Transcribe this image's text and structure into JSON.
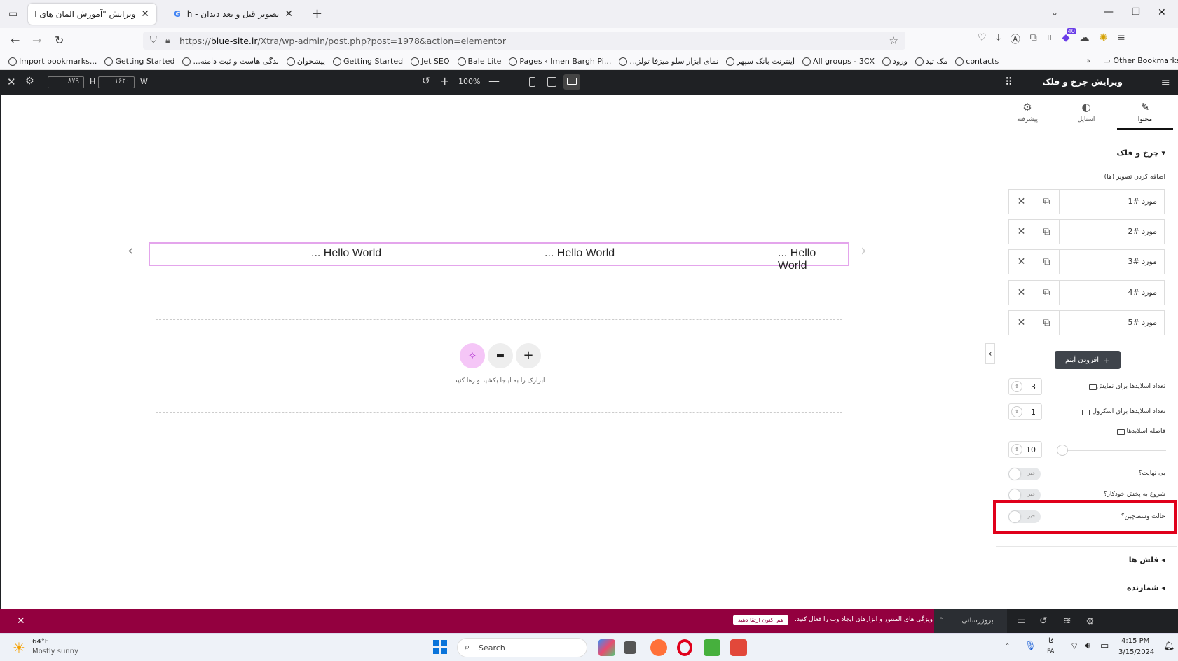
{
  "browser": {
    "tabs": [
      {
        "title": "ویرایش \"آموزش المان های اکسترا – ا"
      },
      {
        "title": "تصویر قبل و بعد دندان - Search"
      }
    ],
    "url_prefix": "https://",
    "url_host": "blue-site.ir",
    "url_path": "/Xtra/wp-admin/post.php?post=1978&action=elementor",
    "bookmarks": [
      "Import bookmarks...",
      "Getting Started",
      "...ندگی هاست و ثبت دامنه",
      "پیشخوان",
      "Getting Started",
      "Jet SEO",
      "Bale Lite",
      "Pages ‹ Imen Bargh Pi...",
      "...نمای ابزار سلو میزفا تولز",
      "اینترنت بانک سپهر",
      "All groups - 3CX",
      "ورود",
      "مک تید",
      "contacts"
    ],
    "other_bookmarks": "Other Bookmarks",
    "extension_badge": "40"
  },
  "editor_top": {
    "height_label": "H",
    "height_value": "۸۷۹",
    "width_label": "W",
    "width_value": "۱۶۲۰",
    "zoom": "100%"
  },
  "canvas": {
    "slides": [
      "... Hello World",
      "... Hello World",
      "... Hello World"
    ],
    "drop_hint": "ابزارک را به اینجا بکشید و رها کنید"
  },
  "panel": {
    "title": "ویرایش چرخ و فلک",
    "tabs": [
      {
        "label": "محتوا"
      },
      {
        "label": "استایل"
      },
      {
        "label": "پیشرفته"
      }
    ],
    "section_title": "چرخ و فلک",
    "images_label": "اضافه کردن تصویر (ها)",
    "items": [
      "مورد #1",
      "مورد #2",
      "مورد #3",
      "مورد #4",
      "مورد #5"
    ],
    "add_item": "افزودن آیتم",
    "slides_to_show_label": "تعداد اسلایدها برای نمایش",
    "slides_to_show": "3",
    "slides_to_scroll_label": "تعداد اسلایدها برای اسکرول",
    "slides_to_scroll": "1",
    "spacing_label": "فاصله اسلایدها",
    "spacing": "10",
    "infinite_label": "بی نهایت؟",
    "autoplay_label": "شروع به پخش خودکار؟",
    "center_label": "حالت وسط‌چین؟",
    "toggle_off": "خیر",
    "arrows_section": "فلش ها",
    "dots_section": "شمارنده"
  },
  "notice": {
    "text": "قدرت کامل ویژگی های المنتور و ابزارهای ایجاد وب را فعال کنید.",
    "button": "هم اکنون ارتقا دهید"
  },
  "footer": {
    "update": "بروزرسانی"
  },
  "taskbar": {
    "temp": "64°F",
    "weather": "Mostly sunny",
    "search": "Search",
    "lang_top": "فا",
    "lang_bottom": "FA",
    "time": "4:15 PM",
    "date": "3/15/2024"
  },
  "colors": {
    "accent_red": "#e0001b",
    "notice_bg": "#93003f",
    "editor_dark": "#1f2124"
  }
}
